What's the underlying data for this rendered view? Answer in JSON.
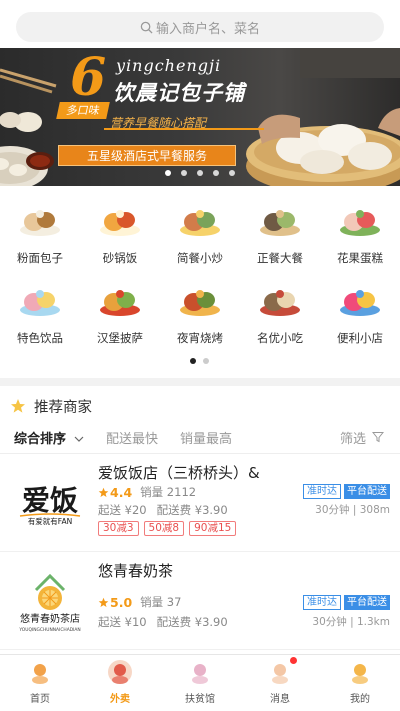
{
  "search": {
    "placeholder": "输入商户名、菜名"
  },
  "banner": {
    "number": "6",
    "flavor_tag": "多口味",
    "pinyin": "yingchengji",
    "shop_title": "饮晨记包子铺",
    "slogan": "营养早餐随心搭配",
    "service": "五星级酒店式早餐服务",
    "active_dot": 0,
    "dot_count": 5
  },
  "categories": [
    {
      "label": "粉面包子",
      "icon": "noodle-bun-icon"
    },
    {
      "label": "砂锅饭",
      "icon": "claypot-rice-icon"
    },
    {
      "label": "简餐小炒",
      "icon": "stir-fry-icon"
    },
    {
      "label": "正餐大餐",
      "icon": "feast-icon"
    },
    {
      "label": "花果蛋糕",
      "icon": "cake-icon"
    },
    {
      "label": "特色饮品",
      "icon": "drink-icon"
    },
    {
      "label": "汉堡披萨",
      "icon": "burger-icon"
    },
    {
      "label": "夜宵烧烤",
      "icon": "bbq-icon"
    },
    {
      "label": "名优小吃",
      "icon": "snack-icon"
    },
    {
      "label": "便利小店",
      "icon": "store-basket-icon"
    }
  ],
  "category_pages": {
    "count": 2,
    "active": 0
  },
  "recommend": {
    "title": "推荐商家"
  },
  "sort": {
    "comprehensive": "综合排序",
    "fastest": "配送最快",
    "top_sales": "销量最高",
    "filter": "筛选"
  },
  "shops": [
    {
      "name": "爱饭饭店（三桥桥头）&",
      "rating": "4.4",
      "sales": "销量 2112",
      "min_order": "起送 ¥20",
      "delivery_fee": "配送费 ¥3.90",
      "promos": [
        "30减3",
        "50减8",
        "90减15"
      ],
      "tag_ontime": "准时达",
      "tag_platform": "平台配送",
      "distance": "30分钟 | 308m",
      "logo": "aifan-logo"
    },
    {
      "name": "悠青春奶茶",
      "rating": "5.0",
      "sales": "销量 37",
      "min_order": "起送 ¥10",
      "delivery_fee": "配送费 ¥3.90",
      "promos": [],
      "tag_ontime": "准时达",
      "tag_platform": "平台配送",
      "distance": "30分钟 | 1.3km",
      "logo": "youqingchun-logo"
    }
  ],
  "logos": {
    "aifan_main": "爱饭",
    "aifan_slogan": "有爱就有FAN",
    "youqing_main": "悠青春奶茶店",
    "youqing_pinyin": "YOUQINGCHUNNAICHADIAN"
  },
  "tabs": [
    {
      "label": "首页",
      "icon": "home-icon",
      "active": false
    },
    {
      "label": "外卖",
      "icon": "takeout-icon",
      "active": true
    },
    {
      "label": "扶贫馆",
      "icon": "poverty-aid-icon",
      "active": false
    },
    {
      "label": "消息",
      "icon": "message-icon",
      "active": false,
      "badge": true
    },
    {
      "label": "我的",
      "icon": "profile-icon",
      "active": false
    }
  ],
  "colors": {
    "accent": "#f39a18",
    "promo_red": "#e95050",
    "platform_blue": "#3a8ee6",
    "badge_red": "#ff3333"
  }
}
